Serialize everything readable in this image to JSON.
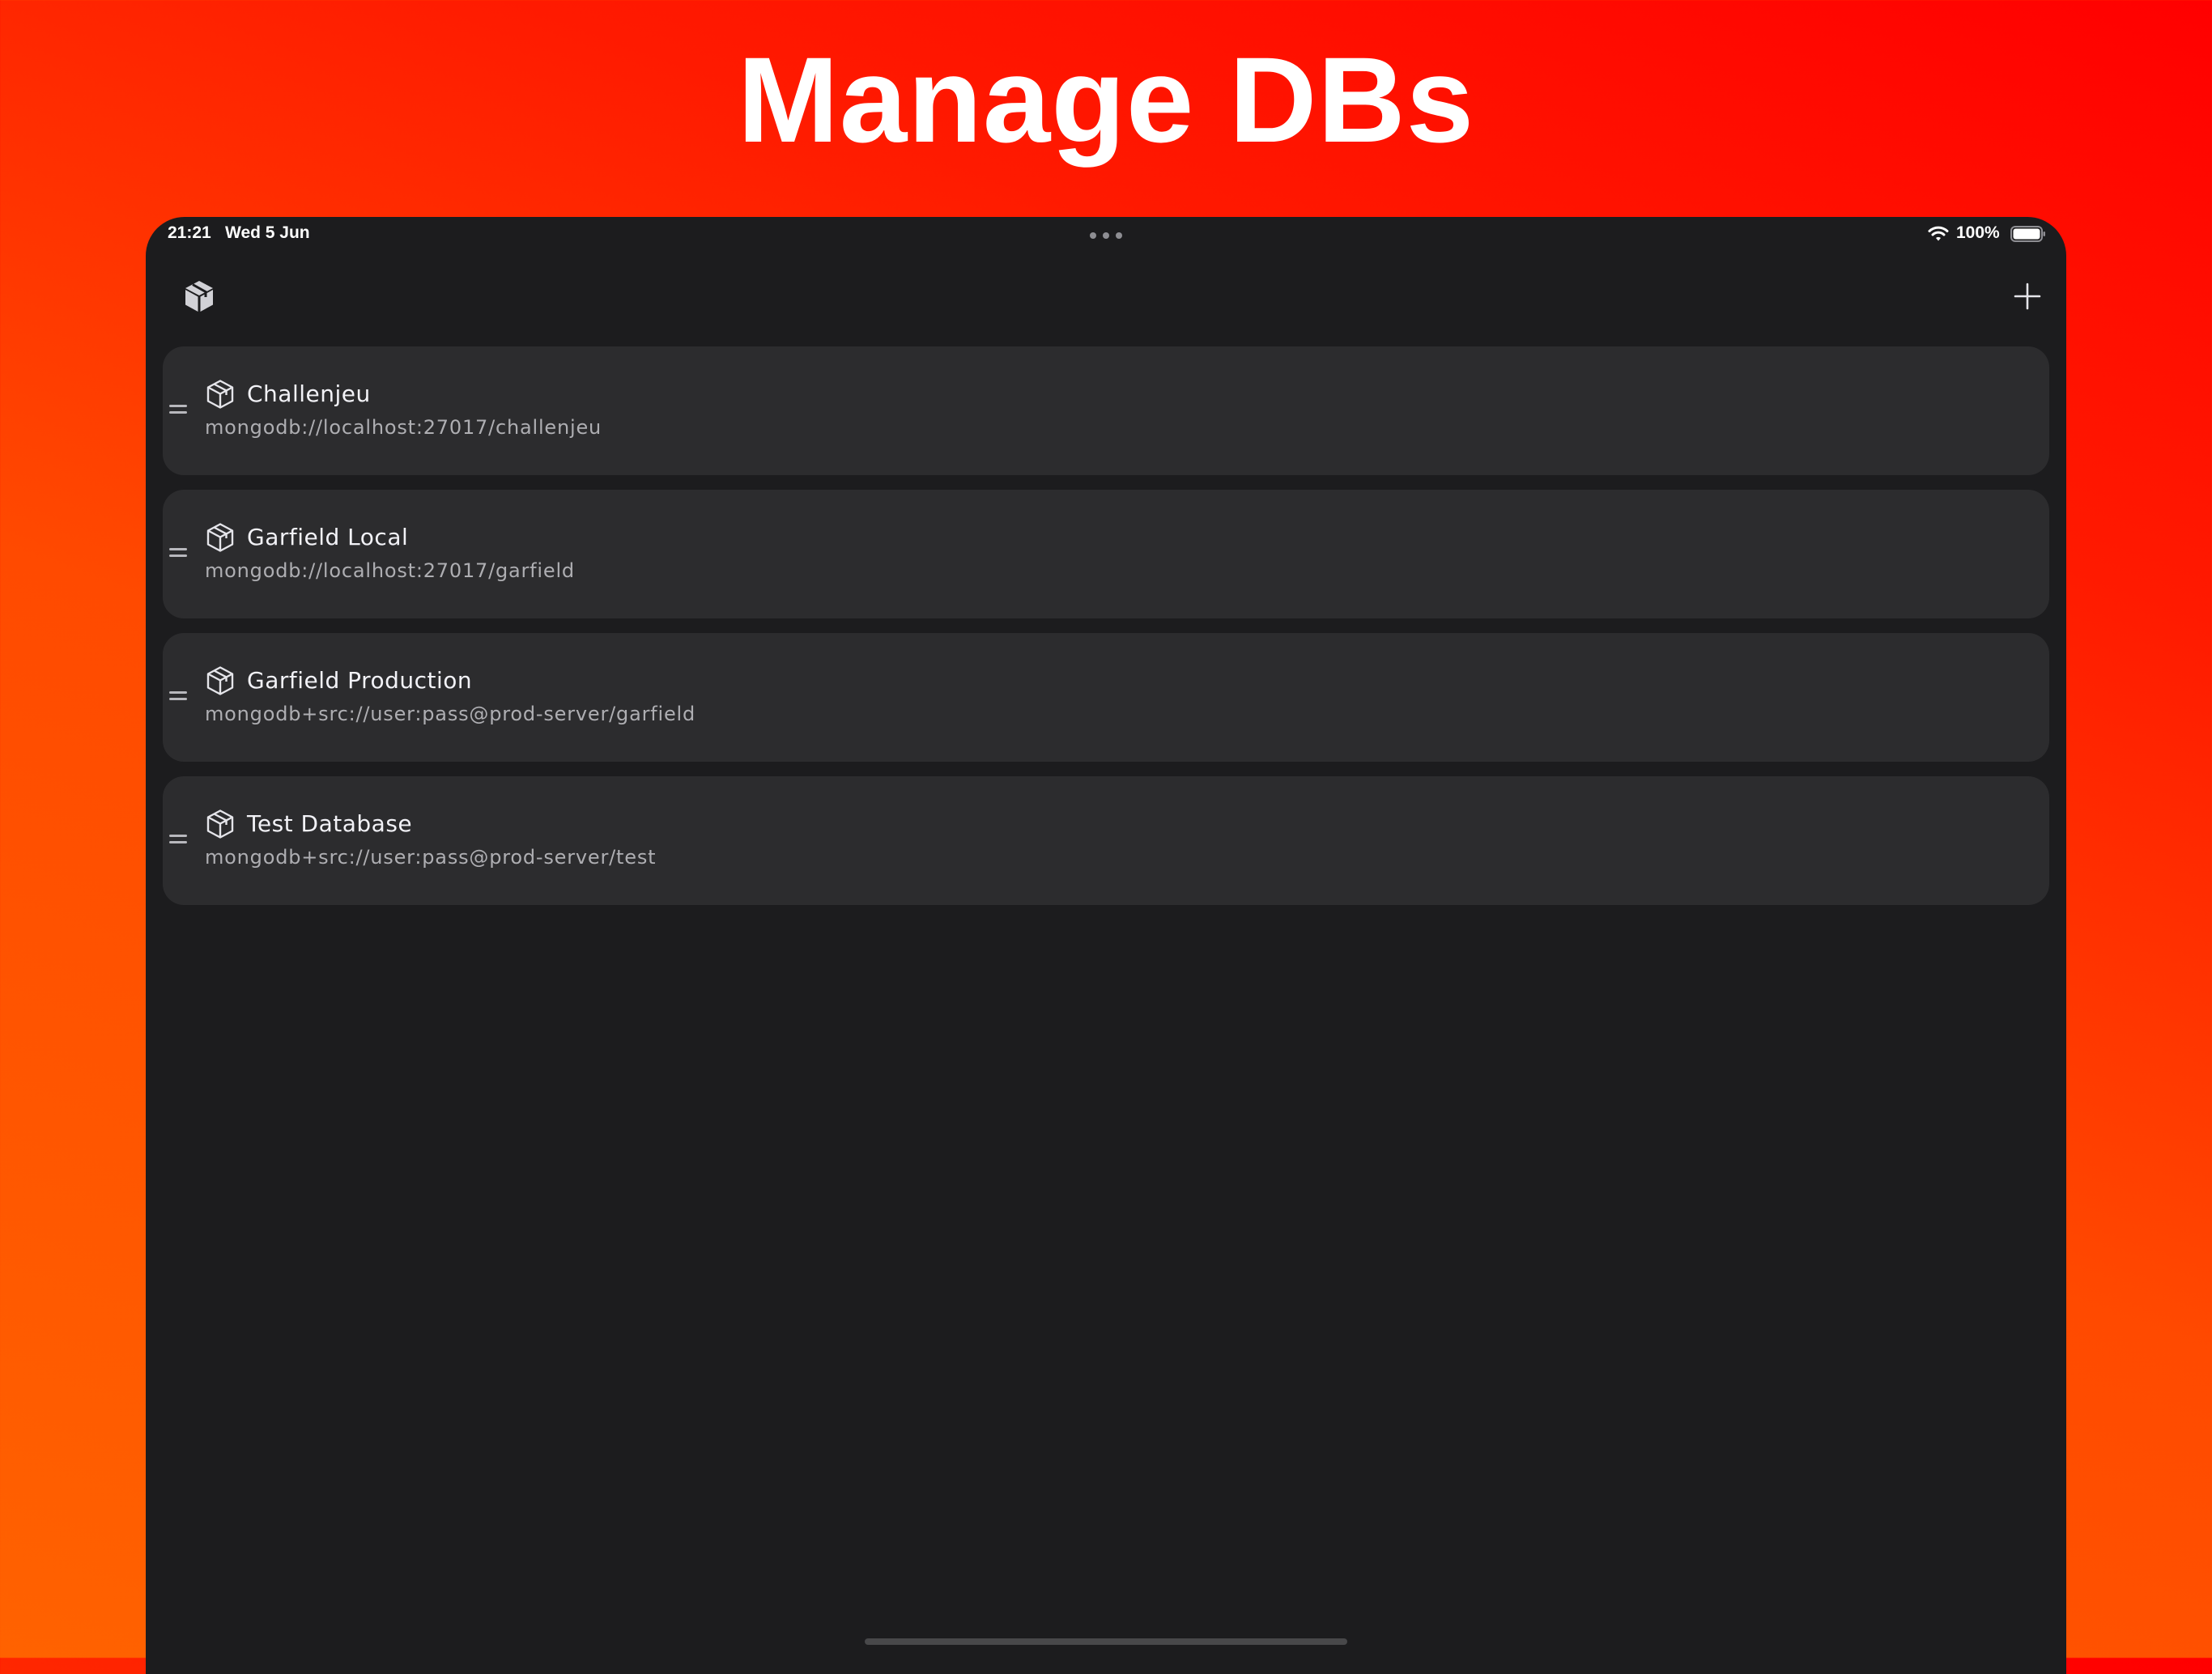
{
  "headline": "Manage DBs",
  "status_bar": {
    "time": "21:21",
    "date": "Wed 5 Jun",
    "battery_percent": "100%",
    "battery_level": 1.0
  },
  "nav_bar": {
    "left_icon": "cube-icon",
    "right_icon": "plus-icon"
  },
  "databases": [
    {
      "name": "Challenjeu",
      "url": "mongodb://localhost:27017/challenjeu"
    },
    {
      "name": "Garfield Local",
      "url": "mongodb://localhost:27017/garfield"
    },
    {
      "name": "Garfield Production",
      "url": "mongodb+src://user:pass@prod-server/garfield"
    },
    {
      "name": "Test Database",
      "url": "mongodb+src://user:pass@prod-server/test"
    }
  ],
  "colors": {
    "background_top": "#ff0000",
    "background_bottom": "#ff6200",
    "device_bg": "#1c1c1e",
    "card_bg": "#2c2c2e",
    "title_text": "#f2f2f7",
    "subtitle_text": "#aeaeb2"
  }
}
